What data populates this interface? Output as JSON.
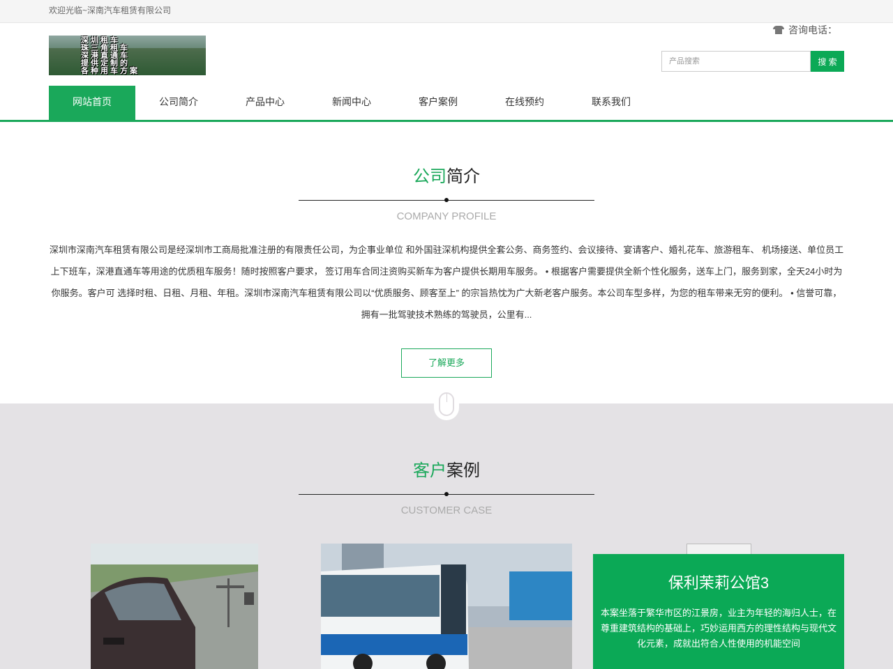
{
  "topbar": {
    "welcome": "欢迎光临~深南汽车租赁有限公司"
  },
  "header": {
    "logo_lines": [
      "深圳租车",
      "珠三角租车",
      "深港直通车",
      "提供定制的",
      "各种用车方案"
    ],
    "phone_label": "咨询电话：",
    "search_placeholder": "产品搜索",
    "search_button": "搜 索"
  },
  "nav": {
    "items": [
      "网站首页",
      "公司简介",
      "产品中心",
      "新闻中心",
      "客户案例",
      "在线预约",
      "联系我们"
    ]
  },
  "profile": {
    "title_green": "公司",
    "title_black": "简介",
    "title_en": "COMPANY PROFILE",
    "text": "深圳市深南汽车租赁有限公司是经深圳市工商局批准注册的有限责任公司，为企事业单位 和外国驻深机构提供全套公务、商务签约、会议接待、宴请客户、婚礼花车、旅游租车、 机场接送、单位员工上下班车，深港直通车等用途的优质租车服务！随时按照客户要求， 签订用车合同注资购买新车为客户提供长期用车服务。 • 根据客户需要提供全新个性化服务，送车上门，服务到家，全天24小时为你服务。客户可 选择时租、日租、月租、年租。深圳市深南汽车租赁有限公司以“优质服务、顾客至上” 的宗旨热忱为广大新老客户服务。本公司车型多样，为您的租车带来无穷的便利。 • 信誉可靠，拥有一批驾驶技术熟练的驾驶员，公里有...",
    "more_button": "了解更多"
  },
  "cases": {
    "title_green": "客户",
    "title_black": "案例",
    "title_en": "CUSTOMER CASE",
    "featured": {
      "title": "保利茉莉公馆3",
      "desc": "本案坐落于繁华市区的江景房，业主为年轻的海归人士，在尊重建筑结构的基础上，巧妙运用西方的理性结构与现代文化元素，成就出符合人性使用的机能空间"
    }
  },
  "colors": {
    "accent": "#1aa85a",
    "cases_bg": "#e4e2e5"
  }
}
